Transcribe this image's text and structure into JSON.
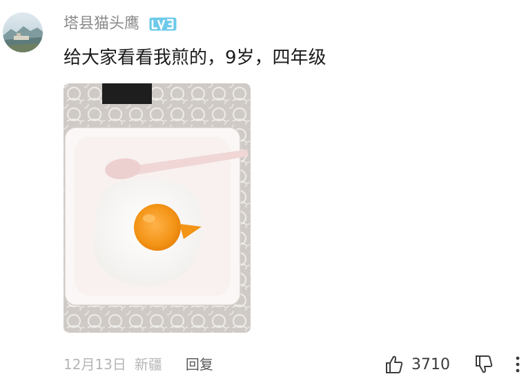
{
  "comment": {
    "username": "塔县猫头鹰",
    "level": "LV3",
    "text": "给大家看看我煎的，9岁，四年级",
    "date": "12月13日",
    "location": "新疆",
    "reply_label": "回复",
    "like_count": "3710"
  },
  "icons": {
    "avatar": "avatar-image",
    "like": "thumbs-up-icon",
    "dislike": "thumbs-down-icon",
    "more": "more-vertical-icon"
  },
  "colors": {
    "username": "#8a8a8a",
    "level_badge": "#6ec9ea",
    "text": "#1a1a1a",
    "meta": "#b5b5b5",
    "reply": "#5a5a5a",
    "egg_yolk": "#f39416"
  }
}
